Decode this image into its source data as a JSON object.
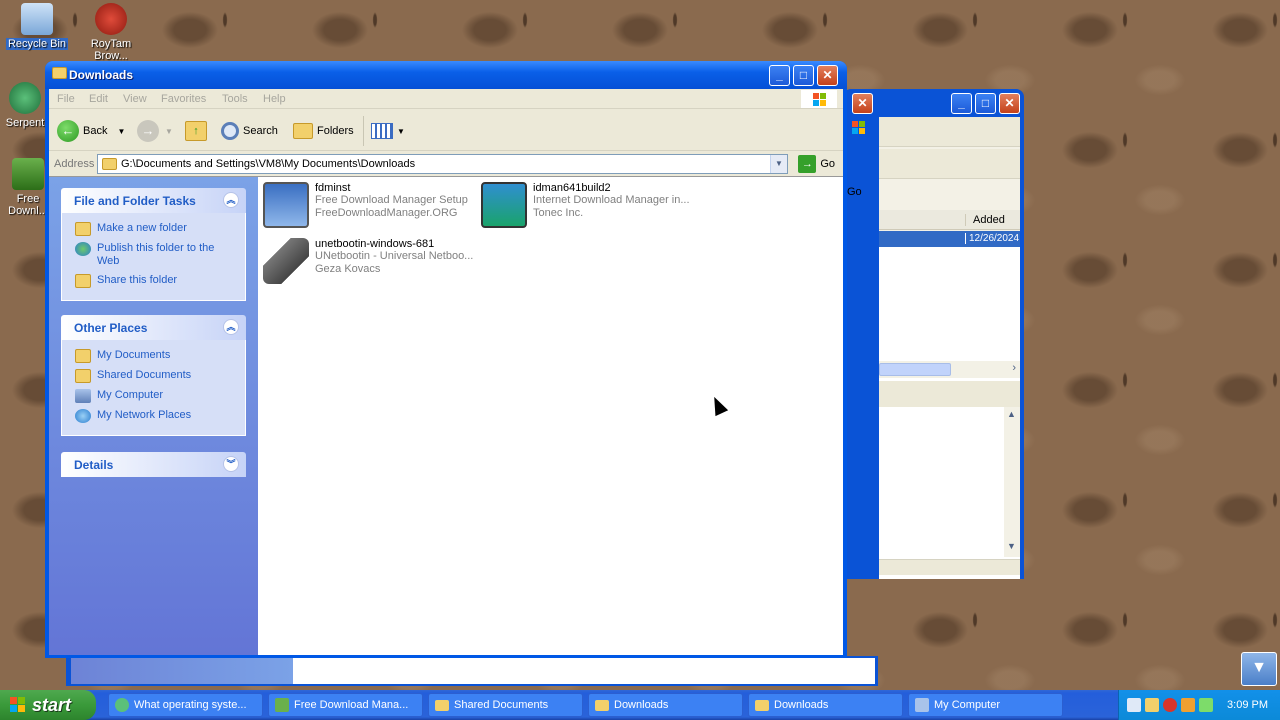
{
  "desktop": {
    "icons": [
      {
        "label": "Recycle Bin"
      },
      {
        "label": "RoyTam Brow..."
      },
      {
        "label": "Serpent"
      },
      {
        "label": "Free Downl..."
      }
    ]
  },
  "background_window": {
    "go_label": "Go",
    "column_added": "Added",
    "row_date": "12/26/2024"
  },
  "window": {
    "title": "Downloads",
    "menu": [
      "File",
      "Edit",
      "View",
      "Favorites",
      "Tools",
      "Help"
    ],
    "toolbar": {
      "back": "Back",
      "search": "Search",
      "folders": "Folders"
    },
    "address": {
      "label": "Address",
      "path": "G:\\Documents and Settings\\VM8\\My Documents\\Downloads",
      "go": "Go"
    },
    "file_tasks": {
      "title": "File and Folder Tasks",
      "items": [
        "Make a new folder",
        "Publish this folder to the Web",
        "Share this folder"
      ]
    },
    "other_places": {
      "title": "Other Places",
      "items": [
        "My Documents",
        "Shared Documents",
        "My Computer",
        "My Network Places"
      ]
    },
    "details": {
      "title": "Details"
    },
    "files": [
      {
        "name": "fdminst",
        "desc": "Free Download Manager Setup",
        "company": "FreeDownloadManager.ORG"
      },
      {
        "name": "idman641build2",
        "desc": "Internet Download Manager in...",
        "company": "Tonec Inc."
      },
      {
        "name": "unetbootin-windows-681",
        "desc": "UNetbootin - Universal Netboo...",
        "company": "Geza Kovacs"
      }
    ]
  },
  "taskbar": {
    "start": "start",
    "buttons": [
      {
        "label": "What operating syste..."
      },
      {
        "label": "Free Download Mana..."
      },
      {
        "label": "Shared Documents"
      },
      {
        "label": "Downloads"
      },
      {
        "label": "Downloads"
      },
      {
        "label": "My Computer"
      }
    ],
    "clock": "3:09 PM"
  }
}
